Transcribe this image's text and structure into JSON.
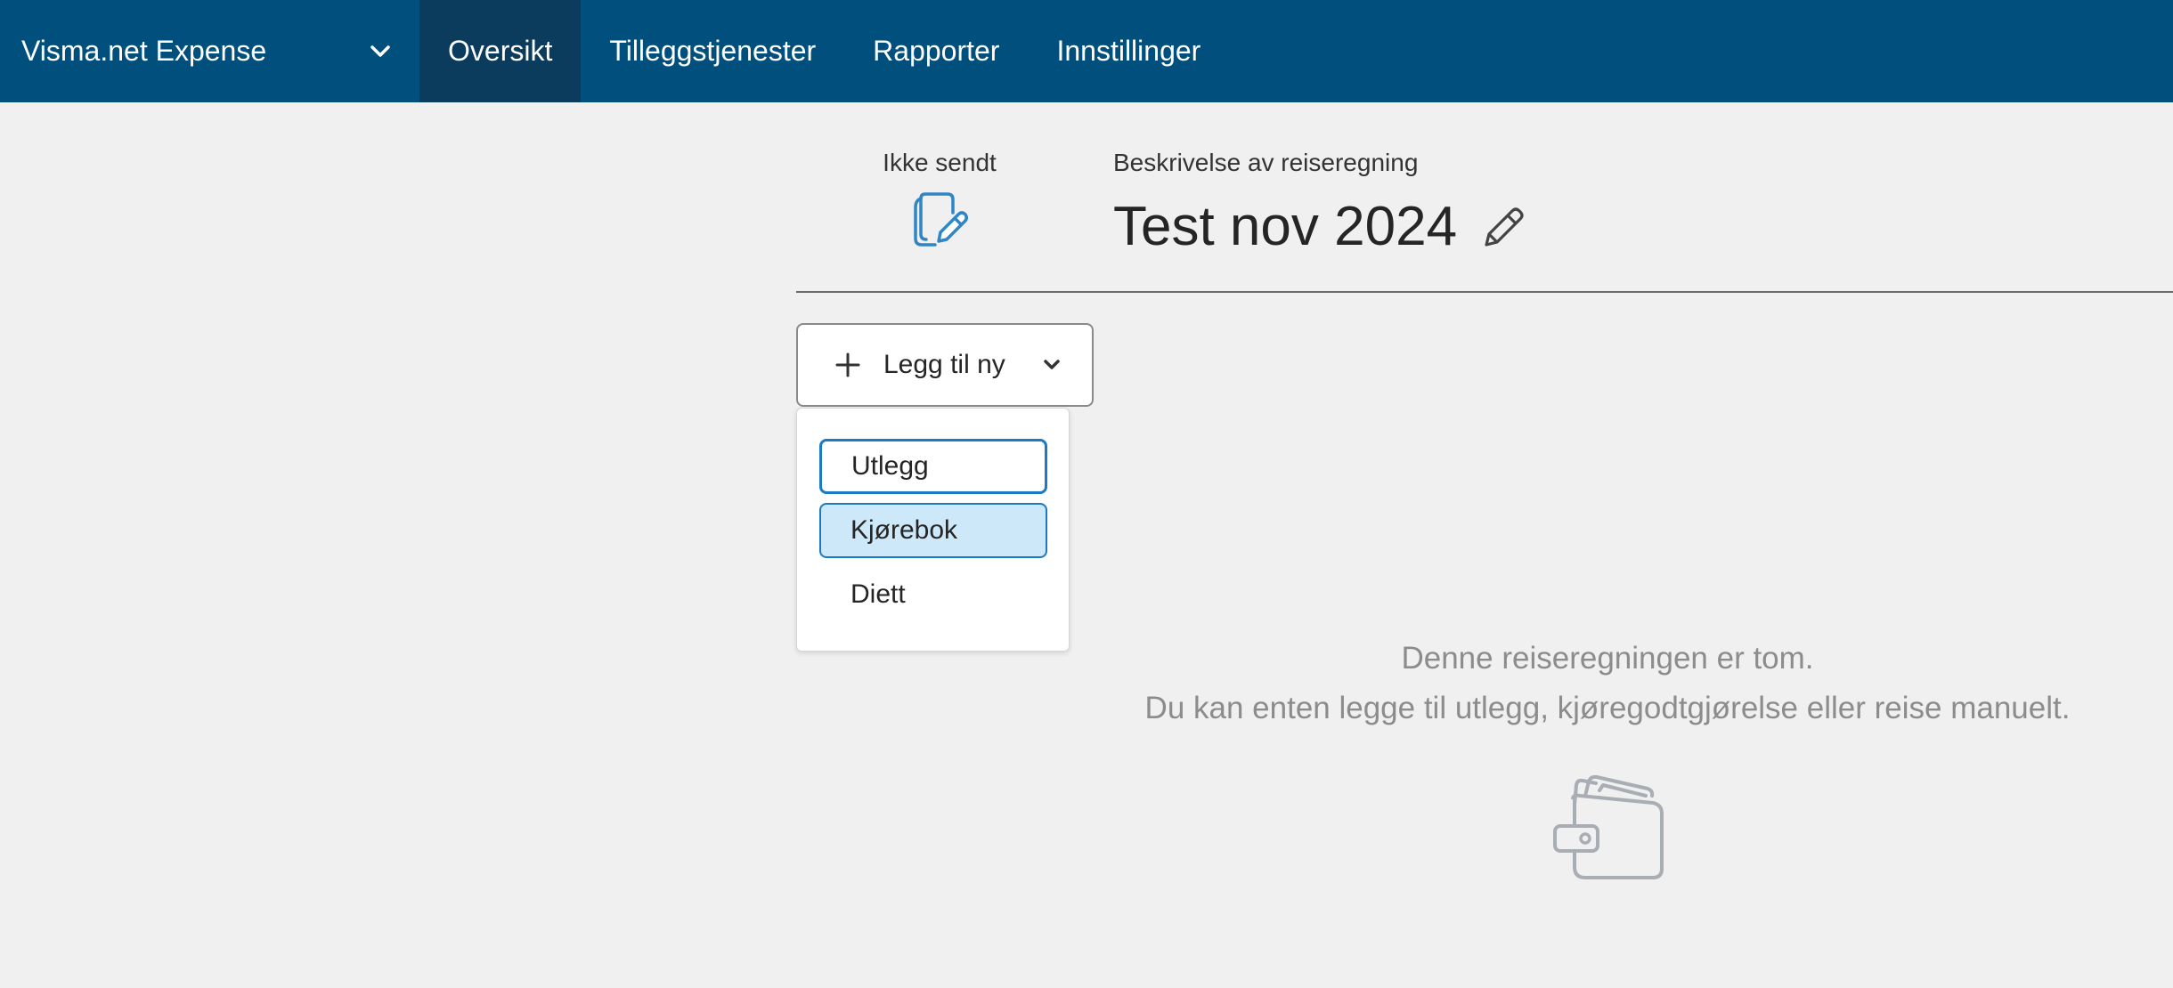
{
  "app": {
    "name": "Visma.net Expense",
    "switcher_icon": "chevron-down-icon"
  },
  "nav": {
    "items": [
      {
        "label": "Oversikt",
        "active": true
      },
      {
        "label": "Tilleggstjenester",
        "active": false
      },
      {
        "label": "Rapporter",
        "active": false
      },
      {
        "label": "Innstillinger",
        "active": false
      }
    ]
  },
  "report": {
    "status_label": "Ikke sendt",
    "status_icon": "draft-document-pencil-icon",
    "description_label": "Beskrivelse av reiseregning",
    "title": "Test nov 2024",
    "edit_icon": "pencil-icon"
  },
  "add_new": {
    "label": "Legg til ny",
    "icon": "plus-icon",
    "menu": [
      {
        "label": "Utlegg",
        "state": "focused"
      },
      {
        "label": "Kjørebok",
        "state": "hovered"
      },
      {
        "label": "Diett",
        "state": "default"
      }
    ]
  },
  "empty_state": {
    "line1": "Denne reiseregningen er tom.",
    "line2": "Du kan enten legge til utlegg, kjøregodtgjørelse eller reise manuelt.",
    "icon": "wallet-icon"
  },
  "colors": {
    "topbar": "#004f7c",
    "topbar_active": "#0b3c5d",
    "accent": "#1b7ac2",
    "hover_bg": "#cde8f8",
    "page_bg": "#f0f0f0"
  }
}
